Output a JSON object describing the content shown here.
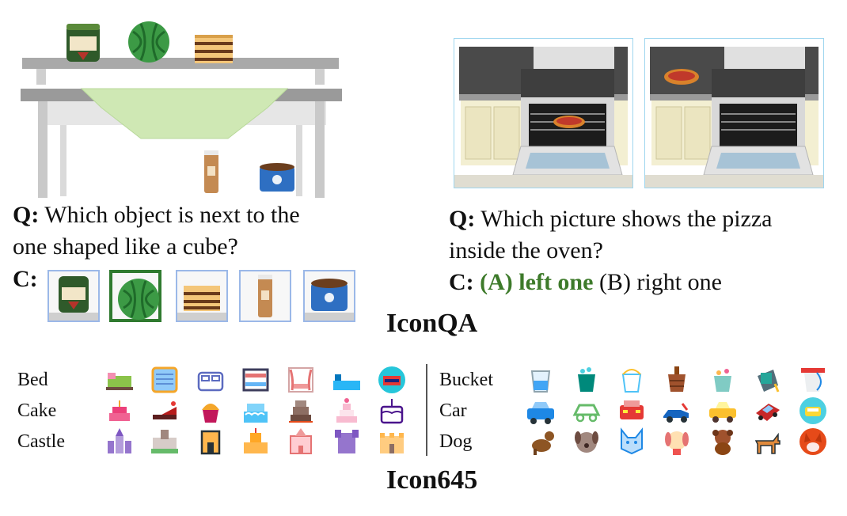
{
  "iconqa": {
    "left": {
      "question_prefix": "Q:",
      "question_text": "Which object is next to the one shaped like a cube?",
      "question_line1": "Which object is next to the",
      "question_line2": "one shaped like a cube?",
      "choices_prefix": "C:",
      "choices": [
        {
          "icon": "jar-icon",
          "selected": false
        },
        {
          "icon": "watermelon-icon",
          "selected": true
        },
        {
          "icon": "cake-slice-icon",
          "selected": false
        },
        {
          "icon": "tube-icon",
          "selected": false
        },
        {
          "icon": "tin-can-icon",
          "selected": false
        }
      ],
      "jar_label": "MONSTER"
    },
    "right": {
      "question_prefix": "Q:",
      "question_line1": "Which picture shows the pizza",
      "question_line2": "inside the oven?",
      "choices_prefix": "C:",
      "option_a": "(A) left one",
      "option_b": "(B) right one"
    },
    "caption": "IconQA"
  },
  "icon645": {
    "left_rows": [
      {
        "label": "Bed",
        "icons": [
          "bed-icon",
          "bed-icon",
          "bed-icon",
          "bunk-bed-icon",
          "canopy-bed-icon",
          "bed-icon",
          "bed-icon"
        ]
      },
      {
        "label": "Cake",
        "icons": [
          "cake-icon",
          "cake-slice-icon",
          "cupcake-icon",
          "cake-icon",
          "cake-icon",
          "wedding-cake-icon",
          "cake-icon"
        ]
      },
      {
        "label": "Castle",
        "icons": [
          "castle-icon",
          "castle-icon",
          "tower-icon",
          "sandcastle-icon",
          "castle-icon",
          "castle-icon",
          "castle-icon"
        ]
      }
    ],
    "right_rows": [
      {
        "label": "Bucket",
        "icons": [
          "bucket-icon",
          "bucket-icon",
          "bucket-icon",
          "bucket-icon",
          "bucket-icon",
          "bucket-icon",
          "bucket-icon"
        ]
      },
      {
        "label": "Car",
        "icons": [
          "car-icon",
          "car-icon",
          "car-icon",
          "car-icon",
          "car-icon",
          "car-icon",
          "car-icon"
        ]
      },
      {
        "label": "Dog",
        "icons": [
          "dog-icon",
          "dog-icon",
          "dog-icon",
          "dog-icon",
          "dog-icon",
          "dog-icon",
          "dog-icon"
        ]
      }
    ],
    "caption": "Icon645"
  },
  "colors": {
    "correct_green": "#3d7a2a",
    "choice_border": "#9bb8e8",
    "oven_frame": "#9ed6ef"
  }
}
